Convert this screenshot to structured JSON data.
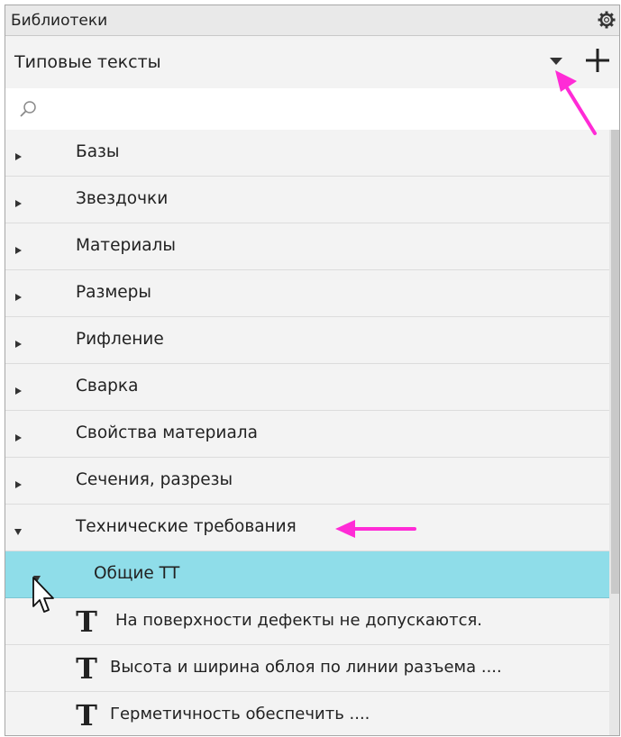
{
  "panel": {
    "title": "Библиотеки",
    "settings_icon": "gear-icon"
  },
  "library_selector": {
    "value": "Типовые тексты",
    "dropdown_icon": "triangle-down-icon",
    "add_icon": "plus-icon"
  },
  "search": {
    "placeholder": "",
    "value": "",
    "icon": "search-icon"
  },
  "tree": {
    "categories": [
      {
        "label": "Базы",
        "expanded": false
      },
      {
        "label": "Звездочки",
        "expanded": false
      },
      {
        "label": "Материалы",
        "expanded": false
      },
      {
        "label": "Размеры",
        "expanded": false
      },
      {
        "label": "Рифление",
        "expanded": false
      },
      {
        "label": "Сварка",
        "expanded": false
      },
      {
        "label": "Свойства материала",
        "expanded": false
      },
      {
        "label": "Сечения, разрезы",
        "expanded": false
      },
      {
        "label": "Технические требования",
        "expanded": true
      }
    ],
    "subgroup": {
      "label": "Общие ТТ",
      "expanded": true,
      "selected": true
    },
    "items": [
      {
        "label": "На поверхности дефекты не допускаются.",
        "icon": "text-t-icon"
      },
      {
        "label": "Высота и ширина облоя по линии разъема ....",
        "icon": "text-t-icon"
      },
      {
        "label": "Герметичность обеспечить ....",
        "icon": "text-t-icon"
      }
    ]
  },
  "colors": {
    "selected_row": "#8fdde9",
    "annotation_arrow": "#ff2bd6"
  }
}
